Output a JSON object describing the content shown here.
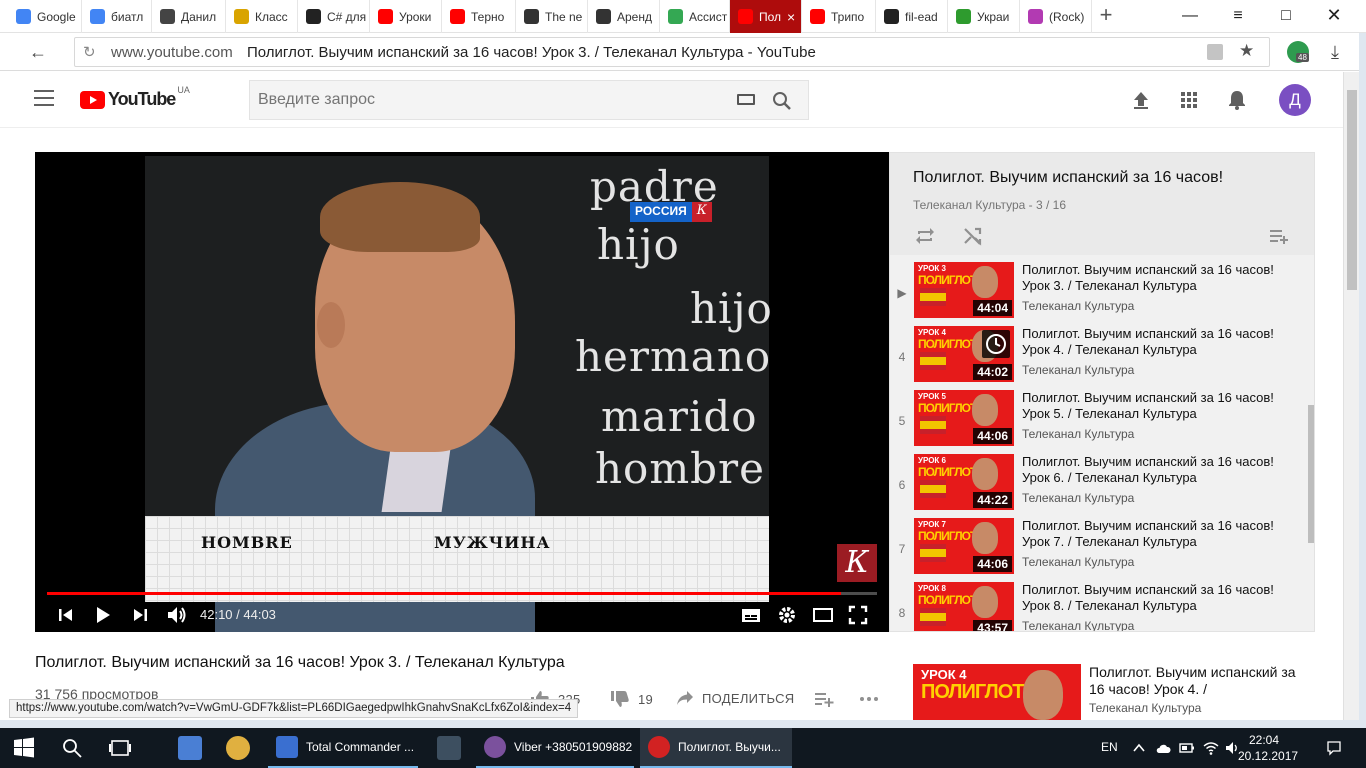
{
  "browser": {
    "tabs": [
      {
        "label": "Google",
        "icon": "google-icon",
        "color": "#4285f4"
      },
      {
        "label": "биатл",
        "icon": "google-g-icon",
        "color": "#4285f4"
      },
      {
        "label": "Данил",
        "icon": "wikipedia-icon",
        "color": "#444444"
      },
      {
        "label": "Класс",
        "icon": "site-icon",
        "color": "#d9a400"
      },
      {
        "label": "C# для",
        "icon": "it-icon",
        "color": "#222222"
      },
      {
        "label": "Уроки",
        "icon": "youtube-icon",
        "color": "#ff0000"
      },
      {
        "label": "Терно",
        "icon": "youtube-icon",
        "color": "#ff0000"
      },
      {
        "label": "The ne",
        "icon": "music-note-icon",
        "color": "#333333"
      },
      {
        "label": "Аренд",
        "icon": "key-icon",
        "color": "#333333"
      },
      {
        "label": "Ассист",
        "icon": "assistant-icon",
        "color": "#34a853"
      },
      {
        "label": "Пол",
        "icon": "youtube-icon",
        "color": "#ff0000",
        "active": true
      },
      {
        "label": "Трипо",
        "icon": "youtube-icon",
        "color": "#ff0000"
      },
      {
        "label": "fil-ead",
        "icon": "github-icon",
        "color": "#222222"
      },
      {
        "label": "Украи",
        "icon": "f-icon",
        "color": "#2e9b2e"
      },
      {
        "label": "(Rock)",
        "icon": "star-icon",
        "color": "#b23ab2"
      }
    ],
    "new_tab_label": "+",
    "url_domain": "www.youtube.com",
    "url_title": "Полиглот. Выучим испанский за 16 часов! Урок 3. / Телеканал Культура - YouTube",
    "extension_badge": "48"
  },
  "youtube": {
    "logo_text": "YouTube",
    "logo_region": "UA",
    "search_placeholder": "Введите запрос",
    "avatar_letter": "Д",
    "accent_color": "#ff0000"
  },
  "player": {
    "chalk_words": [
      "padre",
      "hijo",
      "hijo",
      "hermano",
      "marido",
      "hombre"
    ],
    "channel_badge": "РОССИЯ",
    "channel_badge_k": "К",
    "caption_left": "HOMBRE",
    "caption_right": "МУЖЧИНА",
    "kultura_logo": "К",
    "time_current": "42:10",
    "time_total": "44:03",
    "time_display": "42:10 / 44:03",
    "progress": 0.957
  },
  "playlist": {
    "title": "Полиглот. Выучим испанский за 16 часов!",
    "subtitle": "Телеканал Культура - 3 / 16",
    "items": [
      {
        "index": "▶",
        "lesson": "УРОК 3",
        "title": "Полиглот. Выучим испанский за 16 часов! Урок 3. / Телеканал Культура",
        "channel": "Телеканал Культура",
        "duration": "44:04"
      },
      {
        "index": "4",
        "lesson": "УРОК 4",
        "title": "Полиглот. Выучим испанский за 16 часов! Урок 4. / Телеканал Культура",
        "channel": "Телеканал Культура",
        "duration": "44:02",
        "watch_later": true
      },
      {
        "index": "5",
        "lesson": "УРОК 5",
        "title": "Полиглот. Выучим испанский за 16 часов! Урок 5. / Телеканал Культура",
        "channel": "Телеканал Культура",
        "duration": "44:06"
      },
      {
        "index": "6",
        "lesson": "УРОК 6",
        "title": "Полиглот. Выучим испанский за 16 часов! Урок 6. / Телеканал Культура",
        "channel": "Телеканал Культура",
        "duration": "44:22"
      },
      {
        "index": "7",
        "lesson": "УРОК 7",
        "title": "Полиглот. Выучим испанский за 16 часов! Урок 7. / Телеканал Культура",
        "channel": "Телеканал Культура",
        "duration": "44:06"
      },
      {
        "index": "8",
        "lesson": "УРОК 8",
        "title": "Полиглот. Выучим испанский за 16 часов! Урок 8. / Телеканал Культура",
        "channel": "Телеканал Культура",
        "duration": "43:57"
      }
    ],
    "thumb_brand": "ПОЛИГЛОТ"
  },
  "video": {
    "title": "Полиглот. Выучим испанский за 16 часов! Урок 3. / Телеканал Культура",
    "views": "31 756 просмотров",
    "likes": "325",
    "dislikes": "19",
    "share_label": "ПОДЕЛИТЬСЯ"
  },
  "up_next": {
    "lesson": "УРОК 4",
    "brand": "ПОЛИГЛОТ",
    "title": "Полиглот. Выучим испанский за 16 часов! Урок 4. /",
    "channel": "Телеканал Культура"
  },
  "status_url": "https://www.youtube.com/watch?v=VwGmU-GDF7k&list=PL66DIGaegedpwIhkGnahvSnaKcLfx6ZoI&index=4",
  "taskbar": {
    "apps": [
      {
        "label": "Total Commander ...",
        "color": "#3a6fd0"
      },
      {
        "label": "Viber +380501909882",
        "color": "#7b519d"
      },
      {
        "label": "Полиглот. Выучи...",
        "color": "#d22222",
        "active": true
      }
    ],
    "language": "EN",
    "time": "22:04",
    "date": "20.12.2017"
  }
}
